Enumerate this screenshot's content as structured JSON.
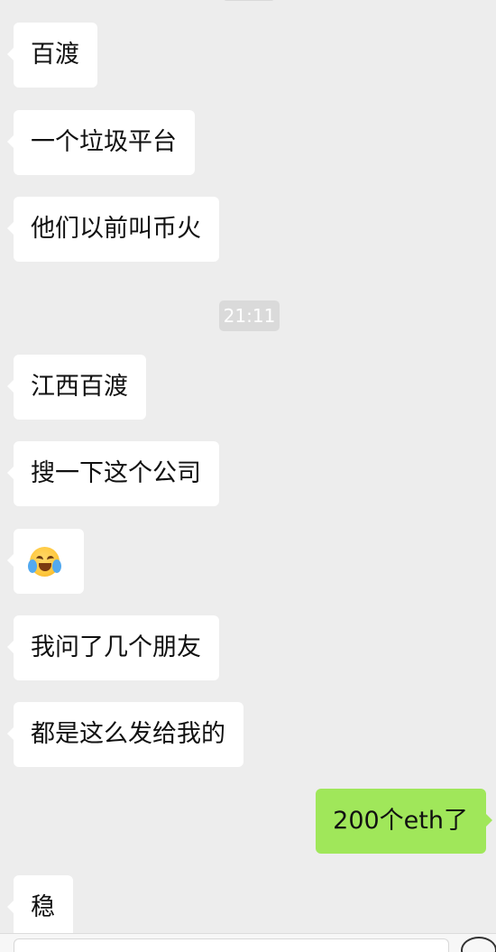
{
  "conversation": {
    "messages": [
      {
        "direction": "incoming",
        "type": "text",
        "text": "百渡"
      },
      {
        "direction": "incoming",
        "type": "text",
        "text": "一个垃圾平台"
      },
      {
        "direction": "incoming",
        "type": "text",
        "text": "他们以前叫币火"
      },
      {
        "direction": "system",
        "type": "timestamp",
        "text": "21:11"
      },
      {
        "direction": "incoming",
        "type": "text",
        "text": "江西百渡"
      },
      {
        "direction": "incoming",
        "type": "text",
        "text": "搜一下这个公司"
      },
      {
        "direction": "incoming",
        "type": "emoji",
        "icon": "laughing-crying-face-icon"
      },
      {
        "direction": "incoming",
        "type": "text",
        "text": "我问了几个朋友"
      },
      {
        "direction": "incoming",
        "type": "text",
        "text": "都是这么发给我的"
      },
      {
        "direction": "outgoing",
        "type": "text",
        "text": "200个eth了"
      },
      {
        "direction": "incoming",
        "type": "text",
        "text": "稳"
      }
    ]
  },
  "colors": {
    "background": "#ededed",
    "incoming_bubble": "#ffffff",
    "outgoing_bubble": "#a0e75a",
    "timestamp_badge": "#dadada"
  }
}
